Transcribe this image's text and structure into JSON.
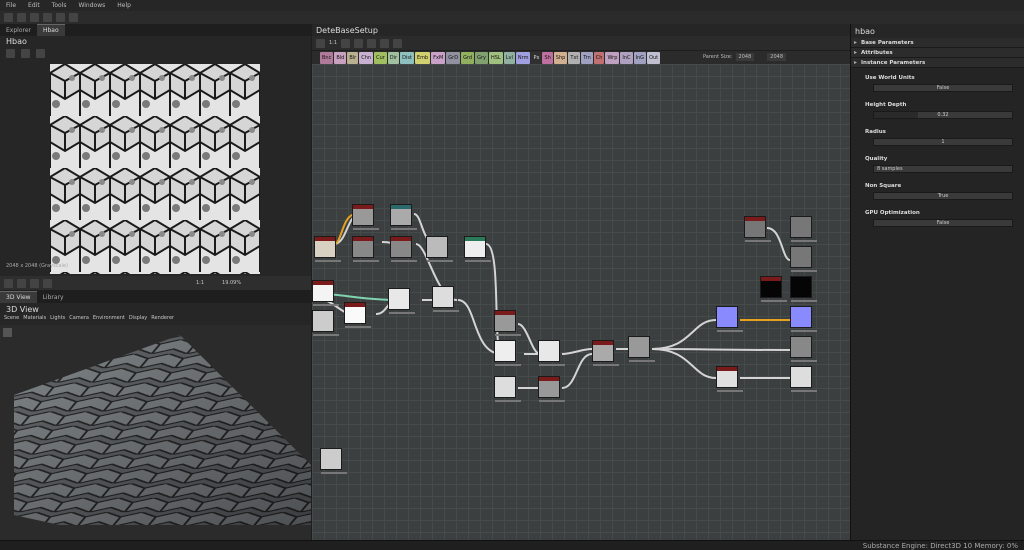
{
  "menu": [
    "File",
    "Edit",
    "Tools",
    "Windows",
    "Help"
  ],
  "explorer_tabs": [
    "Explorer",
    "Hbao"
  ],
  "view2d": {
    "title": "Hbao",
    "info": "2048 x 2048 (Grayscale)",
    "zoom": "19.09%",
    "fit": "1:1"
  },
  "view3d": {
    "tabs": [
      "3D View",
      "Library"
    ],
    "title": "3D View",
    "menu": [
      "Scene",
      "Materials",
      "Lights",
      "Camera",
      "Environment",
      "Display",
      "Renderer"
    ]
  },
  "graph": {
    "title": "DeteBaseSetup",
    "fit": "1:1",
    "chips": [
      {
        "label": "Bnc",
        "color": "#b07a9a"
      },
      {
        "label": "Bld",
        "color": "#c9a0c0"
      },
      {
        "label": "Blr",
        "color": "#b9b090"
      },
      {
        "label": "Chn",
        "color": "#c8b0d0"
      },
      {
        "label": "Cur",
        "color": "#a0c060"
      },
      {
        "label": "Dir",
        "color": "#a0c0a0"
      },
      {
        "label": "Dist",
        "color": "#8fc0c0"
      },
      {
        "label": "Emb",
        "color": "#d0d070"
      },
      {
        "label": "FxM",
        "color": "#c8a0c8"
      },
      {
        "label": "GrD",
        "color": "#9090a0"
      },
      {
        "label": "Grd",
        "color": "#90b060"
      },
      {
        "label": "Gry",
        "color": "#80a070"
      },
      {
        "label": "HSL",
        "color": "#a0c080"
      },
      {
        "label": "Lvl",
        "color": "#90b0a0"
      },
      {
        "label": "Nrm",
        "color": "#a0a0e0"
      },
      {
        "label": "Px",
        "color": "#303030"
      },
      {
        "label": "Sh",
        "color": "#c070a0"
      },
      {
        "label": "Shp",
        "color": "#d0b090"
      },
      {
        "label": "Txt",
        "color": "#b0b0b0"
      },
      {
        "label": "Trn",
        "color": "#a0a0c0"
      },
      {
        "label": "Ch",
        "color": "#c07070"
      },
      {
        "label": "Wrp",
        "color": "#c0a0c0"
      },
      {
        "label": "InC",
        "color": "#b0a0c0"
      },
      {
        "label": "InG",
        "color": "#a0a0c0"
      },
      {
        "label": "Out",
        "color": "#c0c0d0"
      }
    ],
    "parent_size_label": "Parent Size:",
    "parent_size": "2048",
    "size": "2048"
  },
  "properties": {
    "title": "hbao",
    "sections": [
      "Base Parameters",
      "Attributes",
      "Instance Parameters"
    ],
    "params": [
      {
        "label": "Use World Units",
        "value": "False"
      },
      {
        "label": "Height Depth",
        "value": "0.32",
        "fill": 0.32
      },
      {
        "label": "Radius",
        "value": "1"
      },
      {
        "label": "Quality",
        "value": "8 samples"
      },
      {
        "label": "Non Square",
        "value": "True"
      },
      {
        "label": "GPU Optimization",
        "value": "False"
      }
    ]
  },
  "status": {
    "text": "Substance Engine: Direct3D 10   Memory: 0%"
  }
}
